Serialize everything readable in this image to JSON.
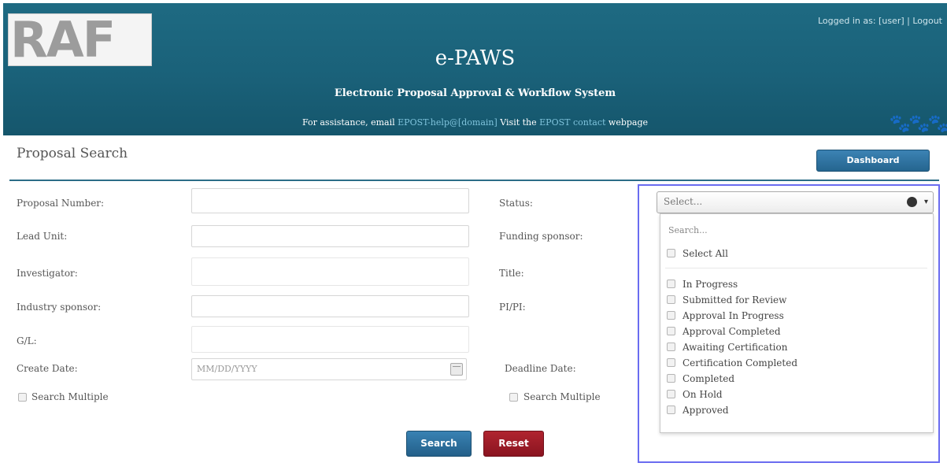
{
  "header": {
    "logo_text": "RAF",
    "logo_subtext": "",
    "top_links": "Logged in as: [user] | Logout",
    "title": "e-PAWS",
    "subtitle": "Electronic Proposal Approval & Workflow System",
    "contact_prefix": "For assistance, email",
    "contact_email": "EPOST-help@[domain]",
    "contact_mid": "Visit the",
    "contact_page": "EPOST contact",
    "contact_suffix": "webpage",
    "paws_icon": "🐾🐾🐾"
  },
  "panel": {
    "title": "Proposal Search",
    "dashboard_label": "Dashboard"
  },
  "form": {
    "left_labels": [
      "Proposal Number:",
      "Lead Unit:",
      "Investigator:",
      "Industry sponsor:",
      "G/L:"
    ],
    "create_date_label": "Create Date:",
    "create_date_placeholder": "MM/DD/YYYY",
    "search_multiple_left": "Search Multiple",
    "right_labels": [
      "Status:",
      "Funding sponsor:",
      "Title:",
      "PI/PI:"
    ],
    "deadline_date_label": "Deadline Date:",
    "search_multiple_right": "Search Multiple"
  },
  "status_select": {
    "selected": "Select...",
    "search_placeholder": "Search...",
    "select_all": "Select All",
    "options": [
      "In Progress",
      "Submitted for Review",
      "Approval In Progress",
      "Approval Completed",
      "Awaiting Certification",
      "Certification Completed",
      "Completed",
      "On Hold",
      "Approved"
    ]
  },
  "buttons": {
    "search": "Search",
    "reset": "Reset"
  },
  "colors": {
    "header_bg": "#1a6179",
    "primary_btn": "#2b6f9c",
    "reset_btn": "#9c1c28",
    "highlight": "#6a6cf0"
  }
}
